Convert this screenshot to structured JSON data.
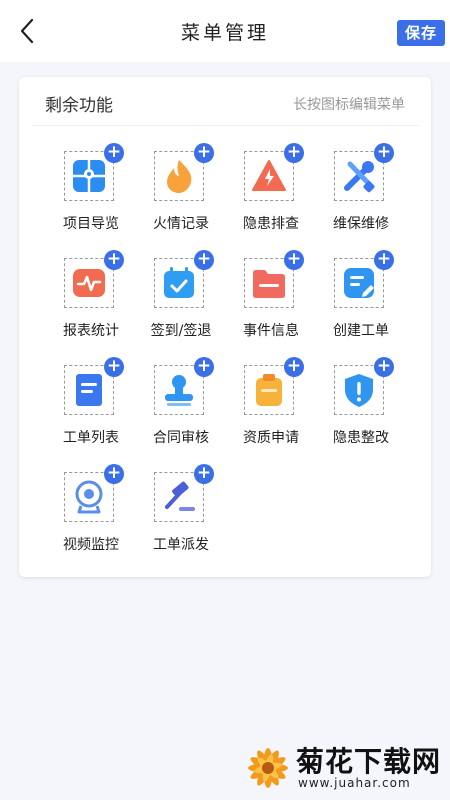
{
  "header": {
    "title": "菜单管理",
    "save_label": "保存"
  },
  "card": {
    "title": "剩余功能",
    "hint": "长按图标编辑菜单"
  },
  "items": [
    {
      "label": "项目导览",
      "icon": "map-grid-icon",
      "color": "#2b8cf2"
    },
    {
      "label": "火情记录",
      "icon": "flame-icon",
      "color": "#f7a23a"
    },
    {
      "label": "隐患排查",
      "icon": "warning-triangle-icon",
      "color": "#f26a4f"
    },
    {
      "label": "维保维修",
      "icon": "wrench-screwdriver-icon",
      "color": "#3b78f0"
    },
    {
      "label": "报表统计",
      "icon": "pulse-chart-icon",
      "color": "#f26a4f"
    },
    {
      "label": "签到/签退",
      "icon": "calendar-check-icon",
      "color": "#2f9ef2"
    },
    {
      "label": "事件信息",
      "icon": "folder-icon",
      "color": "#f26a5f"
    },
    {
      "label": "创建工单",
      "icon": "edit-document-icon",
      "color": "#2f95f0"
    },
    {
      "label": "工单列表",
      "icon": "list-document-icon",
      "color": "#3b78f0"
    },
    {
      "label": "合同审核",
      "icon": "stamp-icon",
      "color": "#2f95f0"
    },
    {
      "label": "资质申请",
      "icon": "clipboard-icon",
      "color": "#f7b23a"
    },
    {
      "label": "隐患整改",
      "icon": "shield-alert-icon",
      "color": "#2f95f0"
    },
    {
      "label": "视频监控",
      "icon": "camera-icon",
      "color": "#5a8ee8"
    },
    {
      "label": "工单派发",
      "icon": "gavel-icon",
      "color": "#4c5fd6"
    }
  ],
  "plus_label": "+",
  "watermark": {
    "text": "菊花下载网",
    "url": "www.juahar.com"
  }
}
